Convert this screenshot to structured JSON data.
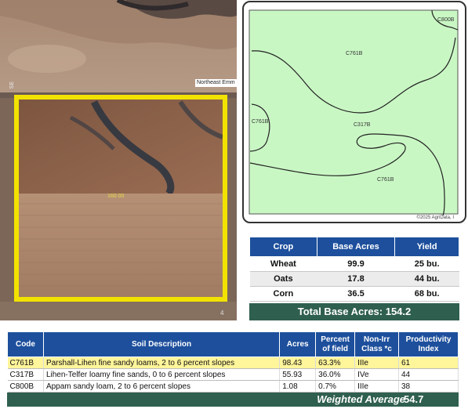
{
  "aerial": {
    "road_label": "Northeast Emm",
    "road_label_left": "SE",
    "acres_label": "160.00",
    "map_number": "4"
  },
  "soil_map": {
    "labels": {
      "c800b": "C800B",
      "c761b_top": "C761B",
      "c761b_left": "C761B",
      "c317b": "C317B",
      "c761b_bottom": "C761B"
    },
    "copyright": "©2025 AgriData, I",
    "fill_color": "#c9f7c4"
  },
  "crop_table": {
    "headers": [
      "Crop",
      "Base Acres",
      "Yield"
    ],
    "rows": [
      {
        "crop": "Wheat",
        "acres": "99.9",
        "yield": "25 bu."
      },
      {
        "crop": "Oats",
        "acres": "17.8",
        "yield": "44 bu."
      },
      {
        "crop": "Corn",
        "acres": "36.5",
        "yield": "68 bu."
      }
    ],
    "total": "Total Base Acres:  154.2"
  },
  "soil_table": {
    "headers": {
      "code": "Code",
      "description": "Soil Description",
      "acres": "Acres",
      "percent_line1": "Percent",
      "percent_line2": "of field",
      "class_line1": "Non-Irr",
      "class_line2": "Class *c",
      "index_line1": "Productivity",
      "index_line2": "Index"
    },
    "rows": [
      {
        "code": "C761B",
        "description": "Parshall-Lihen fine sandy loams, 2 to 6 percent slopes",
        "acres": "98.43",
        "percent": "63.3%",
        "class": "IIIe",
        "index": "61"
      },
      {
        "code": "C317B",
        "description": "Lihen-Telfer loamy fine sands, 0 to 6 percent slopes",
        "acres": "55.93",
        "percent": "36.0%",
        "class": "IVe",
        "index": "44"
      },
      {
        "code": "C800B",
        "description": "Appam sandy loam, 2 to 6 percent slopes",
        "acres": "1.08",
        "percent": "0.7%",
        "class": "IIIe",
        "index": "38"
      }
    ],
    "weighted_label": "Weighted Average",
    "weighted_value": "54.7"
  },
  "colors": {
    "header_blue": "#1d4f9c",
    "total_green": "#2f5f4f",
    "highlight_yellow": "#fff59a",
    "outline_yellow": "#f2e200"
  }
}
